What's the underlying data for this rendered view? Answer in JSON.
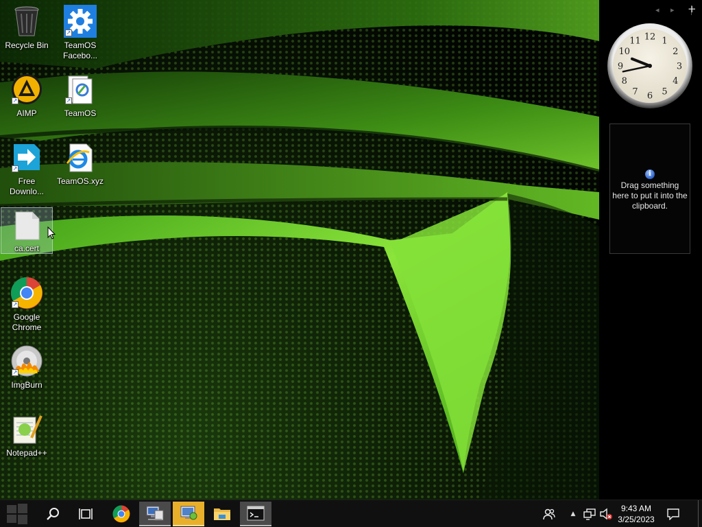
{
  "desktop": {
    "icons": [
      {
        "label": "Recycle Bin",
        "icon": "recycle-bin-icon"
      },
      {
        "label": "TeamOS Facebo...",
        "icon": "gear-icon"
      },
      {
        "label": "AIMP",
        "icon": "aimp-icon"
      },
      {
        "label": "TeamOS",
        "icon": "folder-document-icon"
      },
      {
        "label": "Free Downlo...",
        "icon": "free-download-manager-icon"
      },
      {
        "label": "TeamOS.xyz",
        "icon": "internet-explorer-file-icon"
      },
      {
        "label": "ca.cert",
        "icon": "blank-file-icon",
        "selected": true
      },
      {
        "label": "Google Chrome",
        "icon": "chrome-icon"
      },
      {
        "label": "ImgBurn",
        "icon": "imgburn-disc-icon"
      },
      {
        "label": "Notepad++",
        "icon": "notepad-plus-plus-icon"
      }
    ]
  },
  "sidebar": {
    "controls": [
      "◂",
      "▸",
      "+"
    ],
    "clock": {
      "hour": 9,
      "minute": 43,
      "numerals": [
        "12",
        "1",
        "2",
        "3",
        "4",
        "5",
        "6",
        "7",
        "8",
        "9",
        "10",
        "11"
      ]
    },
    "clipboard": {
      "info_glyph": "i",
      "message": "Drag something here to put it into the clipboard."
    }
  },
  "taskbar": {
    "start": {
      "icon": "windows-start-icon"
    },
    "search": {
      "icon": "search-icon"
    },
    "task_view": {
      "icon": "task-view-icon"
    },
    "apps": [
      {
        "name": "chrome",
        "icon": "chrome-icon",
        "state": "pinned"
      },
      {
        "name": "network-setup",
        "icon": "network-computer-icon",
        "state": "active"
      },
      {
        "name": "control-panel",
        "icon": "control-panel-icon",
        "state": "highlighted"
      },
      {
        "name": "file-explorer",
        "icon": "file-explorer-icon",
        "state": "pinned"
      },
      {
        "name": "command-prompt",
        "icon": "command-prompt-icon",
        "state": "active"
      }
    ],
    "tray": {
      "people_icon": "people-icon",
      "overflow_glyph": "▲",
      "network_icon": "network-icon",
      "volume_icon": "volume-muted-icon",
      "notifications_icon": "notification-icon"
    },
    "clock": {
      "time": "9:43 AM",
      "date": "3/25/2023"
    }
  },
  "colors": {
    "accent": "#e8b02a",
    "wallpaper_green": "#7ed321",
    "taskbar": "#101010"
  }
}
